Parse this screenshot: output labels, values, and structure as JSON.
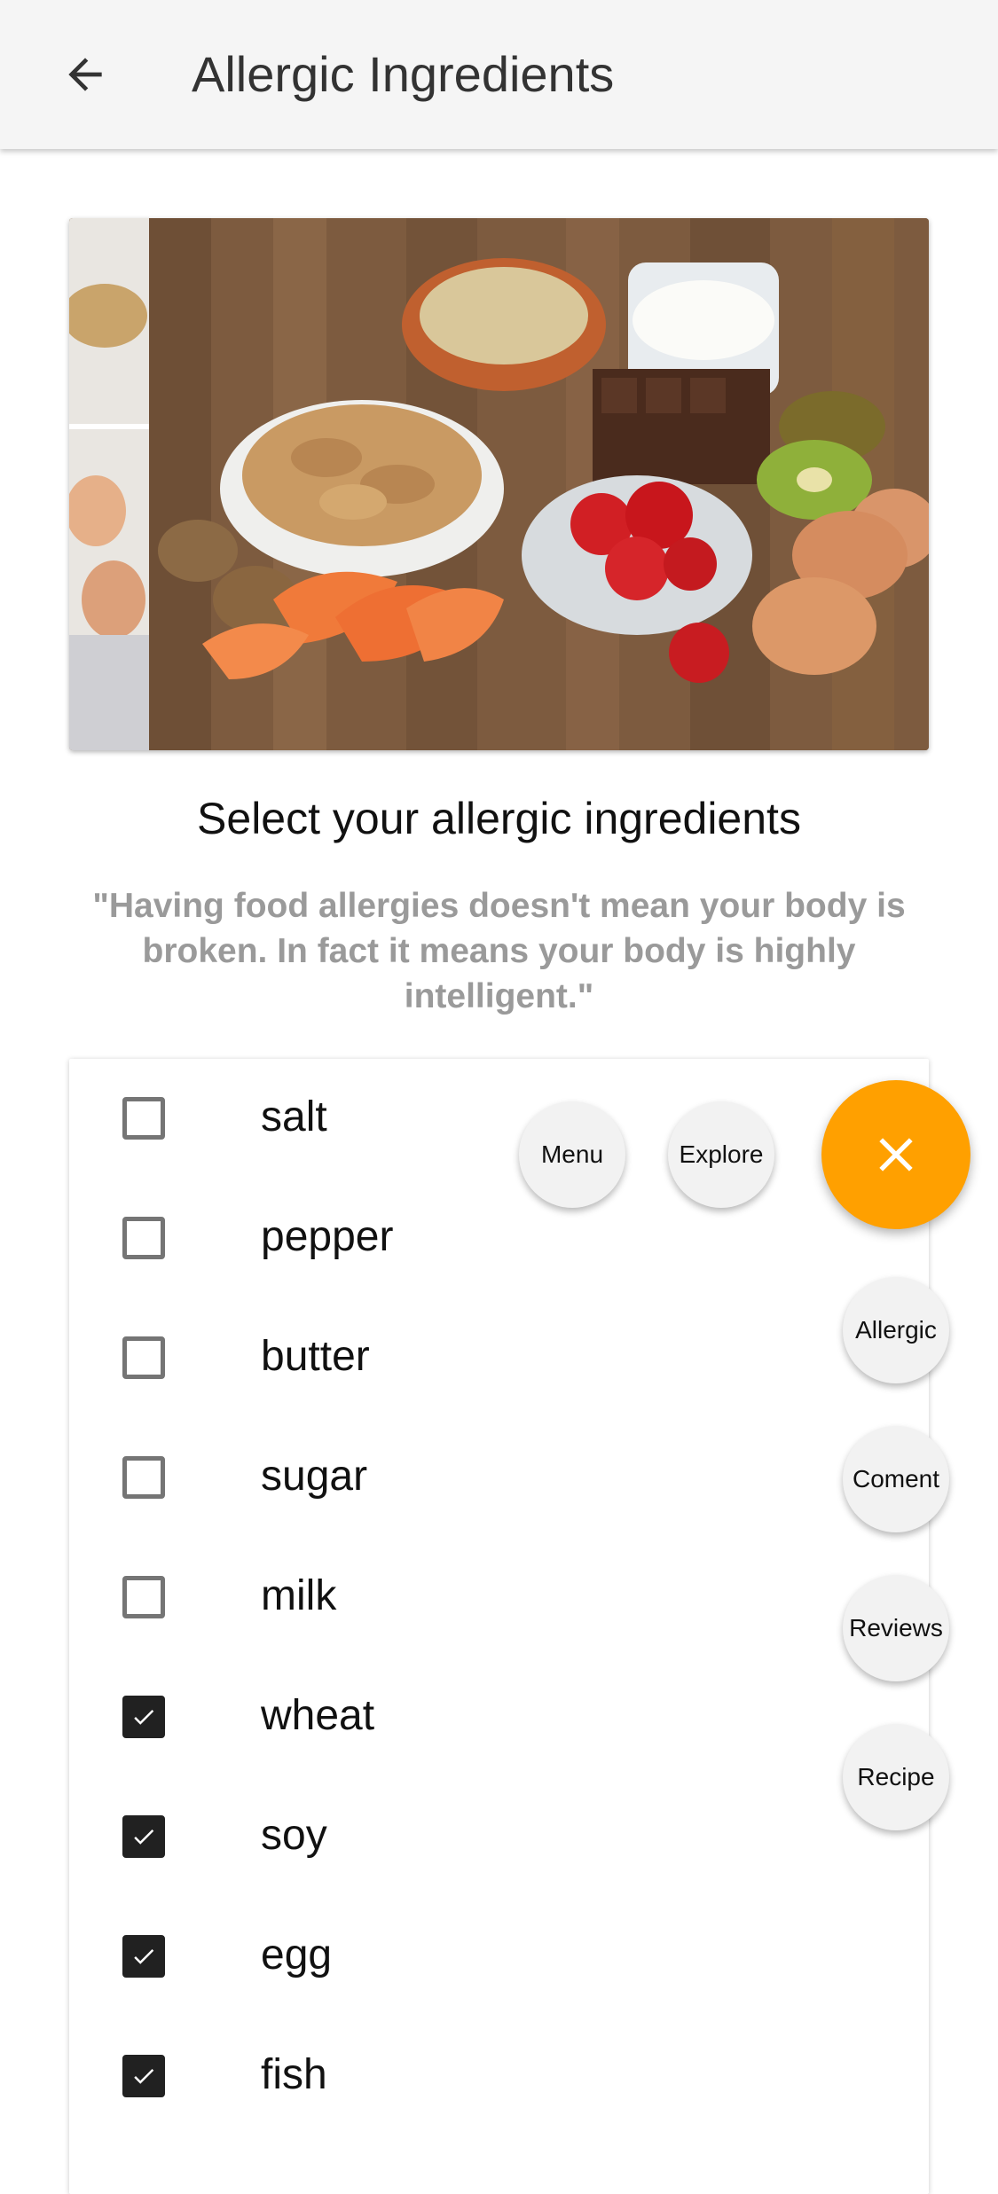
{
  "appbar": {
    "title": "Allergic Ingredients",
    "back_icon": "arrow-back-icon"
  },
  "hero": {
    "image": "allergen-foods-photo"
  },
  "headline": "Select your allergic ingredients",
  "quote": "\"Having food allergies doesn't mean your body is broken. In fact it means your body is highly intelligent.\"",
  "ingredients": [
    {
      "label": "salt",
      "checked": false
    },
    {
      "label": "pepper",
      "checked": false
    },
    {
      "label": "butter",
      "checked": false
    },
    {
      "label": "sugar",
      "checked": false
    },
    {
      "label": "milk",
      "checked": false
    },
    {
      "label": "wheat",
      "checked": true
    },
    {
      "label": "soy",
      "checked": true
    },
    {
      "label": "egg",
      "checked": true
    },
    {
      "label": "fish",
      "checked": true
    }
  ],
  "fab": {
    "main_icon": "close-icon",
    "accent_color": "#ffa000",
    "actions": {
      "menu": "Menu",
      "explore": "Explore",
      "allergic": "Allergic",
      "coment": "Coment",
      "reviews": "Reviews",
      "recipe": "Recipe"
    }
  }
}
